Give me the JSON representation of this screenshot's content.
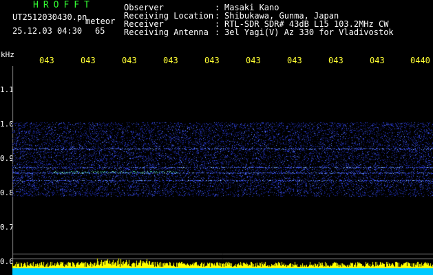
{
  "header": {
    "title": "HROFFT",
    "filename": "UT2512030430.pn",
    "meteor_label": "meteor",
    "datetime": "25.12.03 04:30",
    "meteor_count": "65"
  },
  "info": [
    {
      "label": "Observer",
      "value": "Masaki Kano"
    },
    {
      "label": "Receiving Location",
      "value": "Shibukawa, Gunma, Japan"
    },
    {
      "label": "Receiver",
      "value": "RTL-SDR SDR# 43dB L15 103.2MHz CW"
    },
    {
      "label": "Receiving Antenna",
      "value": "3el Yagi(V) Az 330 for Vladivostok"
    }
  ],
  "info_separator": ":",
  "axis": {
    "y_unit": "kHz",
    "x_ticks": [
      "043",
      "043",
      "043",
      "043",
      "043",
      "043",
      "043",
      "043",
      "043",
      "0440"
    ],
    "y_ticks": [
      "1.1",
      "1.0",
      "0.9",
      "0.8",
      "0.7",
      "0.6"
    ]
  },
  "colors": {
    "title": "#33ff33",
    "text": "#ffffff",
    "ticks": "#ffff33",
    "axis": "#808080",
    "signal": "#3a4dff",
    "bottom_bar": "#ffff00",
    "bottom_base": "#00c8ff"
  }
}
